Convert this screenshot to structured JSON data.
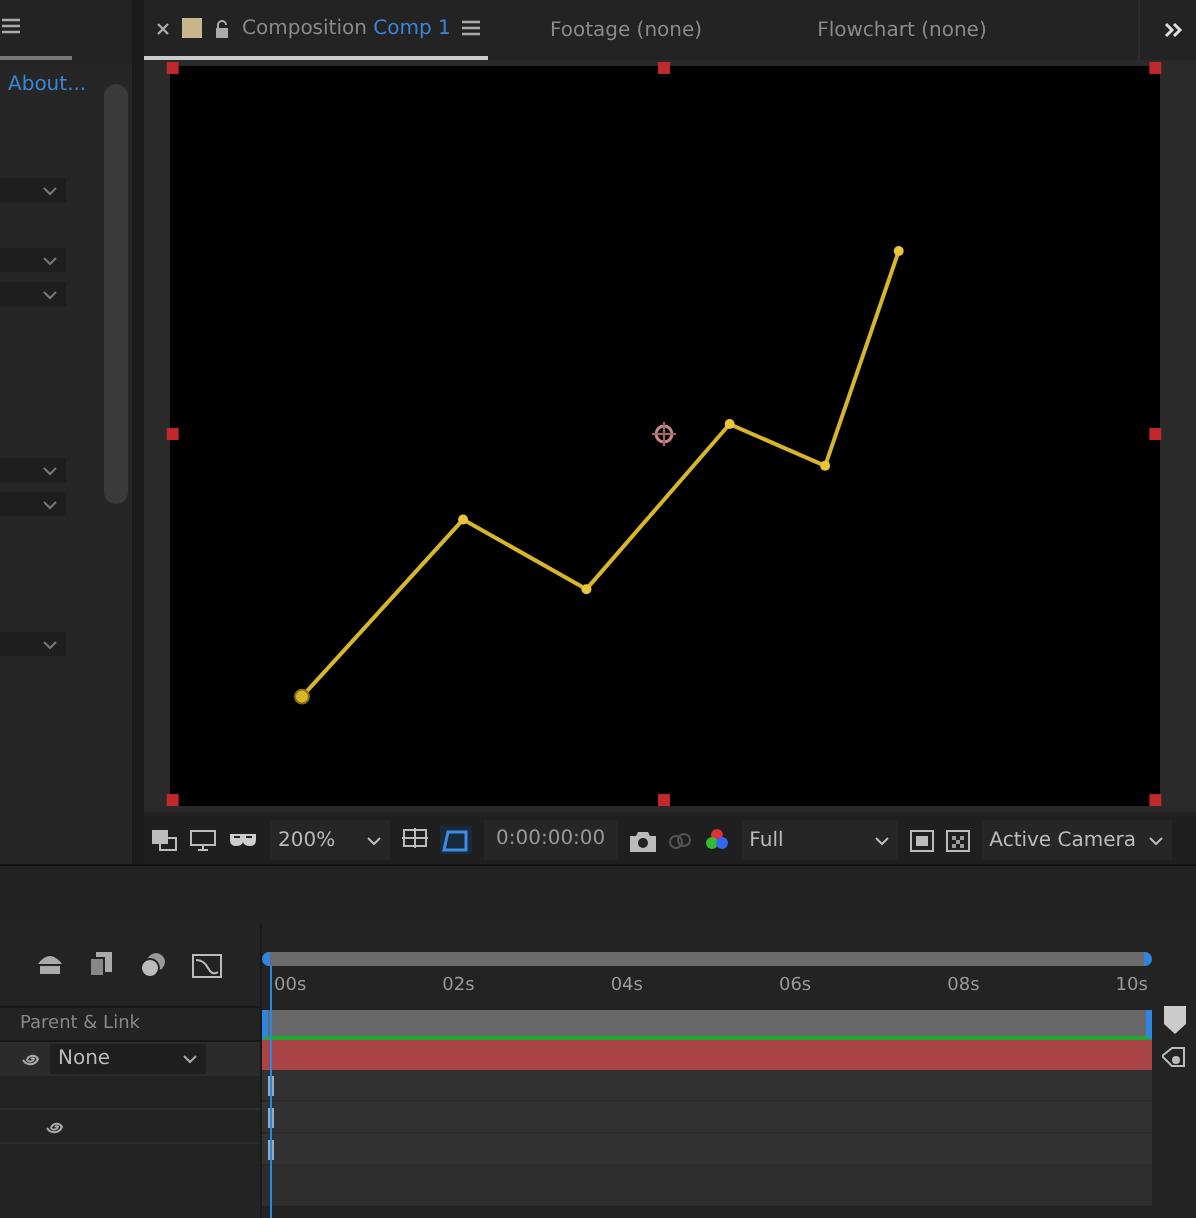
{
  "left_panel": {
    "link": "About..."
  },
  "tabs": [
    {
      "kind": "composition",
      "label": "Composition",
      "name": "Comp 1",
      "selected": true
    },
    {
      "kind": "plain",
      "label": "Footage (none)",
      "selected": false
    },
    {
      "kind": "plain",
      "label": "Flowchart (none)",
      "selected": false
    }
  ],
  "viewer_toolbar": {
    "zoom": "200%",
    "timecode": "0:00:00:00",
    "resolution": "Full",
    "camera": "Active Camera"
  },
  "timeline": {
    "ruler": [
      "00s",
      "02s",
      "04s",
      "06s",
      "08s",
      "10s"
    ],
    "column_header": "Parent & Link",
    "parent": "None"
  }
}
